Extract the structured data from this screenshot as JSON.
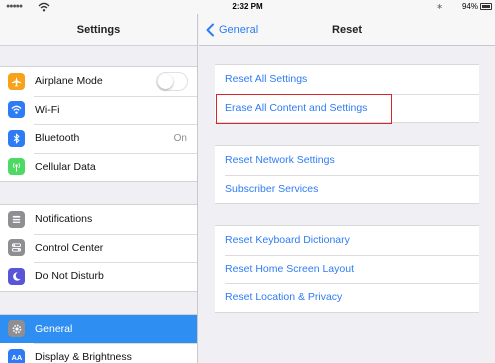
{
  "status_bar": {
    "signal": "●●●●●",
    "time": "2:32 PM",
    "bluetooth_glyph": "∗",
    "battery_text": "94%",
    "battery_level": 0.94
  },
  "sidebar": {
    "title": "Settings",
    "groups": [
      [
        {
          "label": "Airplane Mode",
          "icon": "airplane-icon",
          "color": "#f7a21b",
          "toggle": false
        },
        {
          "label": "Wi-Fi",
          "icon": "wifi-icon",
          "color": "#2d7cf6"
        },
        {
          "label": "Bluetooth",
          "icon": "bluetooth-icon",
          "color": "#2d7cf6",
          "value": "On"
        },
        {
          "label": "Cellular Data",
          "icon": "antenna-icon",
          "color": "#4cd964"
        }
      ],
      [
        {
          "label": "Notifications",
          "icon": "notifications-icon",
          "color": "#8e8e93"
        },
        {
          "label": "Control Center",
          "icon": "switches-icon",
          "color": "#8e8e93"
        },
        {
          "label": "Do Not Disturb",
          "icon": "moon-icon",
          "color": "#5856d6"
        }
      ],
      [
        {
          "label": "General",
          "icon": "gear-icon",
          "color": "#8e8e93",
          "selected": true
        },
        {
          "label": "Display & Brightness",
          "icon": "display-brightness-icon",
          "color": "#2d7cf6"
        }
      ]
    ]
  },
  "main": {
    "back_label": "General",
    "title": "Reset",
    "groups": [
      [
        "Reset All Settings",
        "Erase All Content and Settings"
      ],
      [
        "Reset Network Settings",
        "Subscriber Services"
      ],
      [
        "Reset Keyboard Dictionary",
        "Reset Home Screen Layout",
        "Reset Location & Privacy"
      ]
    ]
  },
  "colors": {
    "accent": "#2e7cf6",
    "selection": "#2e8ef2",
    "highlight_box": "#d7262c"
  }
}
